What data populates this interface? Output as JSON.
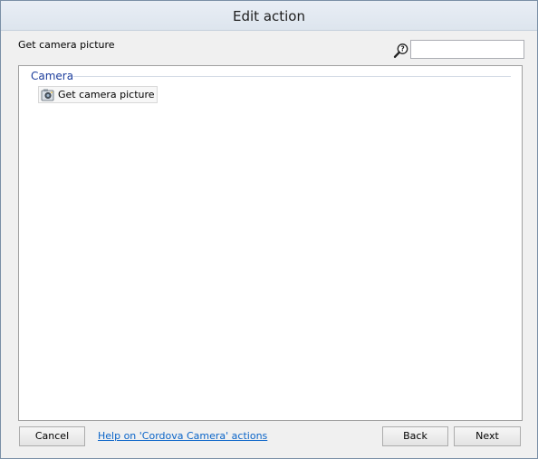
{
  "window": {
    "title": "Edit action"
  },
  "header": {
    "label": "Get camera picture",
    "search": {
      "value": "",
      "placeholder": ""
    },
    "search_icon": "search-help-icon"
  },
  "list": {
    "groups": [
      {
        "name": "Camera",
        "items": [
          {
            "label": "Get camera picture",
            "icon": "camera-icon"
          }
        ]
      }
    ]
  },
  "footer": {
    "cancel_label": "Cancel",
    "help_link": "Help on 'Cordova Camera' actions",
    "back_label": "Back",
    "next_label": "Next"
  },
  "colors": {
    "group_header": "#1c3d9c",
    "link": "#0a64c8",
    "title_bar": "#dde5ee"
  }
}
